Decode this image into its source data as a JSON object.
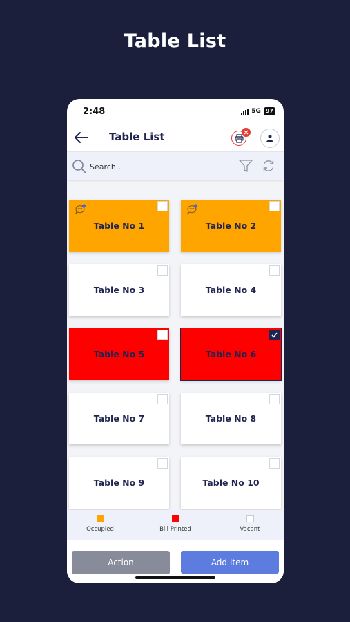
{
  "promo": {
    "title": "Table List"
  },
  "status_bar": {
    "time": "2:48",
    "network": "5G",
    "battery": "97"
  },
  "header": {
    "title": "Table List"
  },
  "search": {
    "placeholder": "Search.."
  },
  "tables": [
    {
      "label": "Table No 1",
      "state": "occupied",
      "color": "#ffa500",
      "checked": false,
      "chat": true
    },
    {
      "label": "Table No 2",
      "state": "occupied",
      "color": "#ffa500",
      "checked": false,
      "chat": true
    },
    {
      "label": "Table No 3",
      "state": "vacant",
      "color": "#ffffff",
      "checked": false,
      "chat": false
    },
    {
      "label": "Table No 4",
      "state": "vacant",
      "color": "#ffffff",
      "checked": false,
      "chat": false
    },
    {
      "label": "Table No 5",
      "state": "bill-printed",
      "color": "#ff0000",
      "checked": false,
      "chat": false
    },
    {
      "label": "Table No 6",
      "state": "bill-printed",
      "color": "#ff0000",
      "checked": true,
      "chat": false
    },
    {
      "label": "Table No 7",
      "state": "vacant",
      "color": "#ffffff",
      "checked": false,
      "chat": false
    },
    {
      "label": "Table No 8",
      "state": "vacant",
      "color": "#ffffff",
      "checked": false,
      "chat": false
    },
    {
      "label": "Table No 9",
      "state": "vacant",
      "color": "#ffffff",
      "checked": false,
      "chat": false
    },
    {
      "label": "Table No 10",
      "state": "vacant",
      "color": "#ffffff",
      "checked": false,
      "chat": false
    }
  ],
  "legend": {
    "occupied": "Occupied",
    "bill_printed": "Bill Printed",
    "vacant": "Vacant"
  },
  "actions": {
    "action_label": "Action",
    "add_item_label": "Add Item"
  },
  "colors": {
    "background": "#1b1f3b",
    "occupied": "#ffa500",
    "bill_printed": "#ff0000",
    "vacant": "#ffffff",
    "action_button": "#878b9a",
    "add_item_button": "#5c7ddf",
    "text_dark": "#1f2550"
  },
  "icons": [
    "back-arrow-icon",
    "printer-icon",
    "close-badge-icon",
    "user-icon",
    "search-icon",
    "filter-icon",
    "refresh-icon",
    "chat-icon",
    "checkmark-icon"
  ]
}
